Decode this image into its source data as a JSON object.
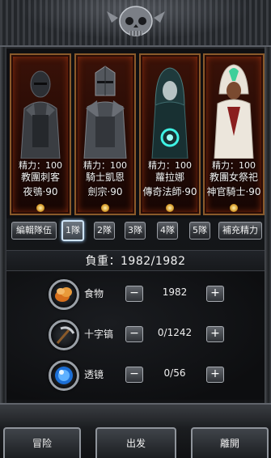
{
  "heroes": [
    {
      "stat": "精力：100",
      "title": "教團刺客",
      "name": "夜鴞·90"
    },
    {
      "stat": "精力：100",
      "title": "騎士凱恩",
      "name": "劍宗·90"
    },
    {
      "stat": "精力：100",
      "title": "蘿拉娜",
      "name": "傳奇法師·90"
    },
    {
      "stat": "精力：100",
      "title": "教團女祭祀",
      "name": "神官騎士·90"
    }
  ],
  "team_bar": {
    "edit_label": "編輯隊伍",
    "teams": [
      "1隊",
      "2隊",
      "3隊",
      "4隊",
      "5隊"
    ],
    "selected_team": "1隊",
    "refill_label": "補充精力"
  },
  "weight": {
    "text": "負重：1982/1982"
  },
  "supplies": [
    {
      "name": "食物",
      "value": "1982",
      "icon": "food-icon"
    },
    {
      "name": "十字镐",
      "value": "0/1242",
      "icon": "pickaxe-icon"
    },
    {
      "name": "透镜",
      "value": "0/56",
      "icon": "lens-icon"
    }
  ],
  "steppers": {
    "minus": "−",
    "plus": "+"
  },
  "bottom_bar": {
    "adventure_label": "冒险",
    "depart_label": "出发",
    "leave_label": "離開"
  },
  "colors": {
    "hero_card_bg": "#3a1208",
    "hero_card_border": "#8a5a2a",
    "selected_team_border": "#cfe4f7"
  }
}
